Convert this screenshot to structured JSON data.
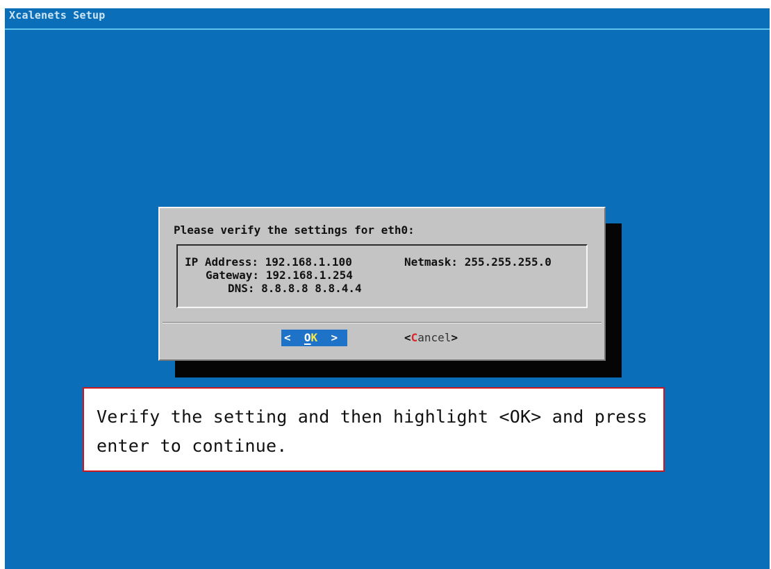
{
  "screen": {
    "backtitle": "Xcalenets Setup",
    "background_color": "#0a6fb8"
  },
  "dialog": {
    "prompt": "Please verify the settings for eth0:",
    "settings": {
      "ip_address": "IP Address: 192.168.1.100",
      "netmask": "Netmask: 255.255.255.0",
      "gateway": "Gateway: 192.168.1.254",
      "dns": "DNS: 8.8.8.8 8.8.4.4"
    },
    "buttons": {
      "ok": {
        "open": "<  ",
        "hotkey": "O",
        "hotkey_second": "K",
        "close": "  >",
        "selected": true,
        "accent_color": "#1e73c8"
      },
      "cancel": {
        "open": "<",
        "hotkey": "C",
        "rest": "ancel",
        "close": ">",
        "hotkey_color": "#d8262b"
      }
    }
  },
  "callout": {
    "text": "Verify the setting and then highlight <OK> and press enter to continue.",
    "border_color": "#d0161d"
  }
}
